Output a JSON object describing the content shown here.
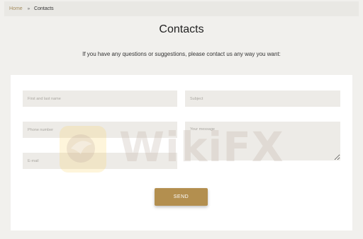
{
  "breadcrumb": {
    "home": "Home",
    "separator": "»",
    "current": "Contacts"
  },
  "page": {
    "title": "Contacts",
    "intro": "If you have any questions or suggestions, please contact us any way you want:"
  },
  "form": {
    "name_placeholder": "First and last name",
    "subject_placeholder": "Subject",
    "phone_placeholder": "Phone number",
    "message_placeholder": "Your message",
    "email_placeholder": "E-mail",
    "send_label": "SEND"
  },
  "watermark": {
    "text": "WikiFX"
  },
  "colors": {
    "accent": "#b38f4f",
    "background": "#f1f0ed",
    "field": "#edebe7",
    "link": "#a48c5e"
  }
}
